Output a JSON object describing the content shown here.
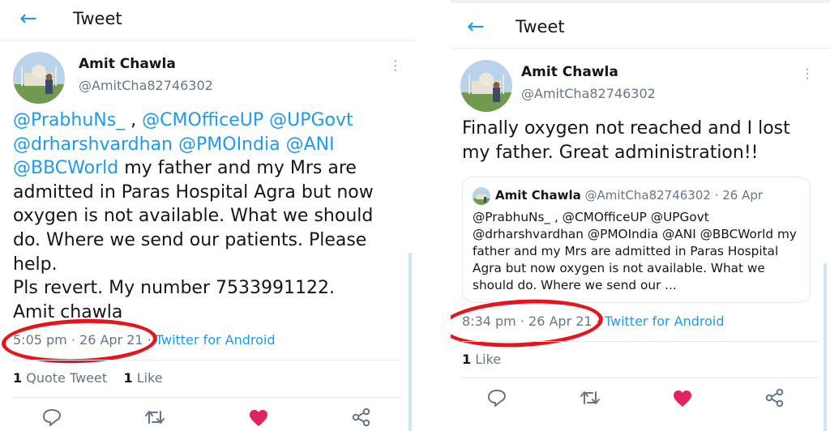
{
  "left": {
    "header": {
      "title": "Tweet"
    },
    "author": {
      "name": "Amit Chawla",
      "handle": "@AmitCha82746302"
    },
    "tweet": {
      "mention_1": "@PrabhuNs_",
      "sep_1": " , ",
      "mention_2": "@CMOfficeUP",
      "mention_3": "@UPGovt",
      "mention_4": "@drharshvardhan",
      "mention_5": "@PMOIndia",
      "mention_6": "@ANI",
      "mention_7": "@BBCWorld",
      "body": " my father and my Mrs are admitted in Paras Hospital Agra but now oxygen is not available. What we should do. Where we send our patients. Please help.",
      "body_2": "Pls revert. My number 7533991122.",
      "body_3": "Amit chawla"
    },
    "meta": {
      "time_date": "5:05 pm · 26 Apr 21",
      "sep": " · ",
      "source": "Twitter for Android"
    },
    "stats": {
      "quote_count": "1",
      "quote_label": "Quote Tweet",
      "like_count": "1",
      "like_label": "Like"
    }
  },
  "right": {
    "header": {
      "title": "Tweet"
    },
    "author": {
      "name": "Amit Chawla",
      "handle": "@AmitCha82746302"
    },
    "tweet": {
      "text": "Finally oxygen not reached and I lost my father. Great administration!!"
    },
    "quote": {
      "name": "Amit Chawla",
      "handle_date": "@AmitCha82746302 · 26 Apr",
      "text": "@PrabhuNs_ , @CMOfficeUP @UPGovt @drharshvardhan @PMOIndia @ANI @BBCWorld my father and my Mrs are admitted in Paras Hospital Agra but now oxygen is not available. What we should do. Where we send our ..."
    },
    "meta": {
      "time_date": "8:34 pm · 26 Apr 21",
      "sep": " · ",
      "source": "Twitter for Android"
    },
    "stats": {
      "like_count": "1",
      "like_label": "Like"
    }
  },
  "icons": {
    "back": "back-arrow-icon",
    "more": "more-vertical-icon",
    "reply": "reply-icon",
    "retweet": "retweet-icon",
    "like": "heart-icon",
    "share": "share-icon"
  },
  "colors": {
    "link": "#1d9bf0",
    "like_filled": "#e0245e",
    "annotation_circle": "#e8141b"
  }
}
